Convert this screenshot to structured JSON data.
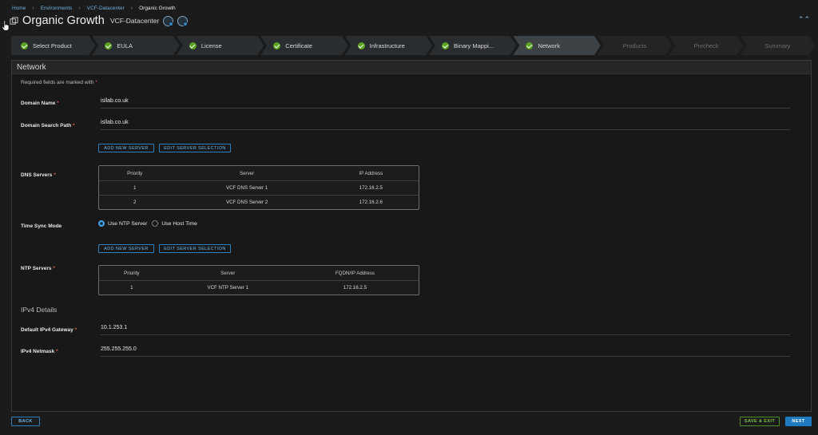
{
  "breadcrumb": [
    "Home",
    "Environments",
    "VCF-Datacenter",
    "Organic Growth"
  ],
  "header": {
    "title": "Organic Growth",
    "subtitle": "VCF-Datacenter"
  },
  "steps": [
    {
      "label": "Select Product",
      "state": "done"
    },
    {
      "label": "EULA",
      "state": "done"
    },
    {
      "label": "License",
      "state": "done"
    },
    {
      "label": "Certificate",
      "state": "done"
    },
    {
      "label": "Infrastructure",
      "state": "done"
    },
    {
      "label": "Binary Mappi...",
      "state": "done"
    },
    {
      "label": "Network",
      "state": "current"
    },
    {
      "label": "Products",
      "state": "pending"
    },
    {
      "label": "Precheck",
      "state": "pending"
    },
    {
      "label": "Summary",
      "state": "pending"
    }
  ],
  "panel": {
    "title": "Network",
    "required_note": "Required fields are marked with",
    "required_mark": "*"
  },
  "fields": {
    "domain_name": {
      "label": "Domain Name",
      "value": "isllab.co.uk"
    },
    "domain_search_path": {
      "label": "Domain Search Path",
      "value": "isllab.co.uk"
    },
    "dns_servers_label": "DNS Servers",
    "time_sync_label": "Time Sync Mode",
    "ntp_servers_label": "NTP Servers",
    "gateway": {
      "label": "Default IPv4 Gateway",
      "value": "10.1.253.1"
    },
    "netmask": {
      "label": "IPv4 Netmask",
      "value": "255.255.255.0"
    }
  },
  "buttons": {
    "add_new_server": "ADD NEW SERVER",
    "edit_server_selection": "EDIT SERVER SELECTION",
    "back": "BACK",
    "save_exit": "SAVE & EXIT",
    "next": "NEXT"
  },
  "time_sync": {
    "options": [
      "Use NTP Server",
      "Use Host Time"
    ],
    "selected": "Use NTP Server"
  },
  "dns_table": {
    "columns": [
      "Priority",
      "Server",
      "IP Address"
    ],
    "rows": [
      [
        "1",
        "VCF DNS Server 1",
        "172.16.2.5"
      ],
      [
        "2",
        "VCF DNS Server 2",
        "172.16.2.6"
      ]
    ]
  },
  "ntp_table": {
    "columns": [
      "Priority",
      "Server",
      "FQDN/IP Address"
    ],
    "rows": [
      [
        "1",
        "VCF NTP Server 1",
        "172.16.2.5"
      ]
    ]
  },
  "ipv4_section": "IPv4 Details",
  "colors": {
    "accent": "#2d7fbd",
    "success": "#5aa220",
    "required": "#e05c5c"
  }
}
